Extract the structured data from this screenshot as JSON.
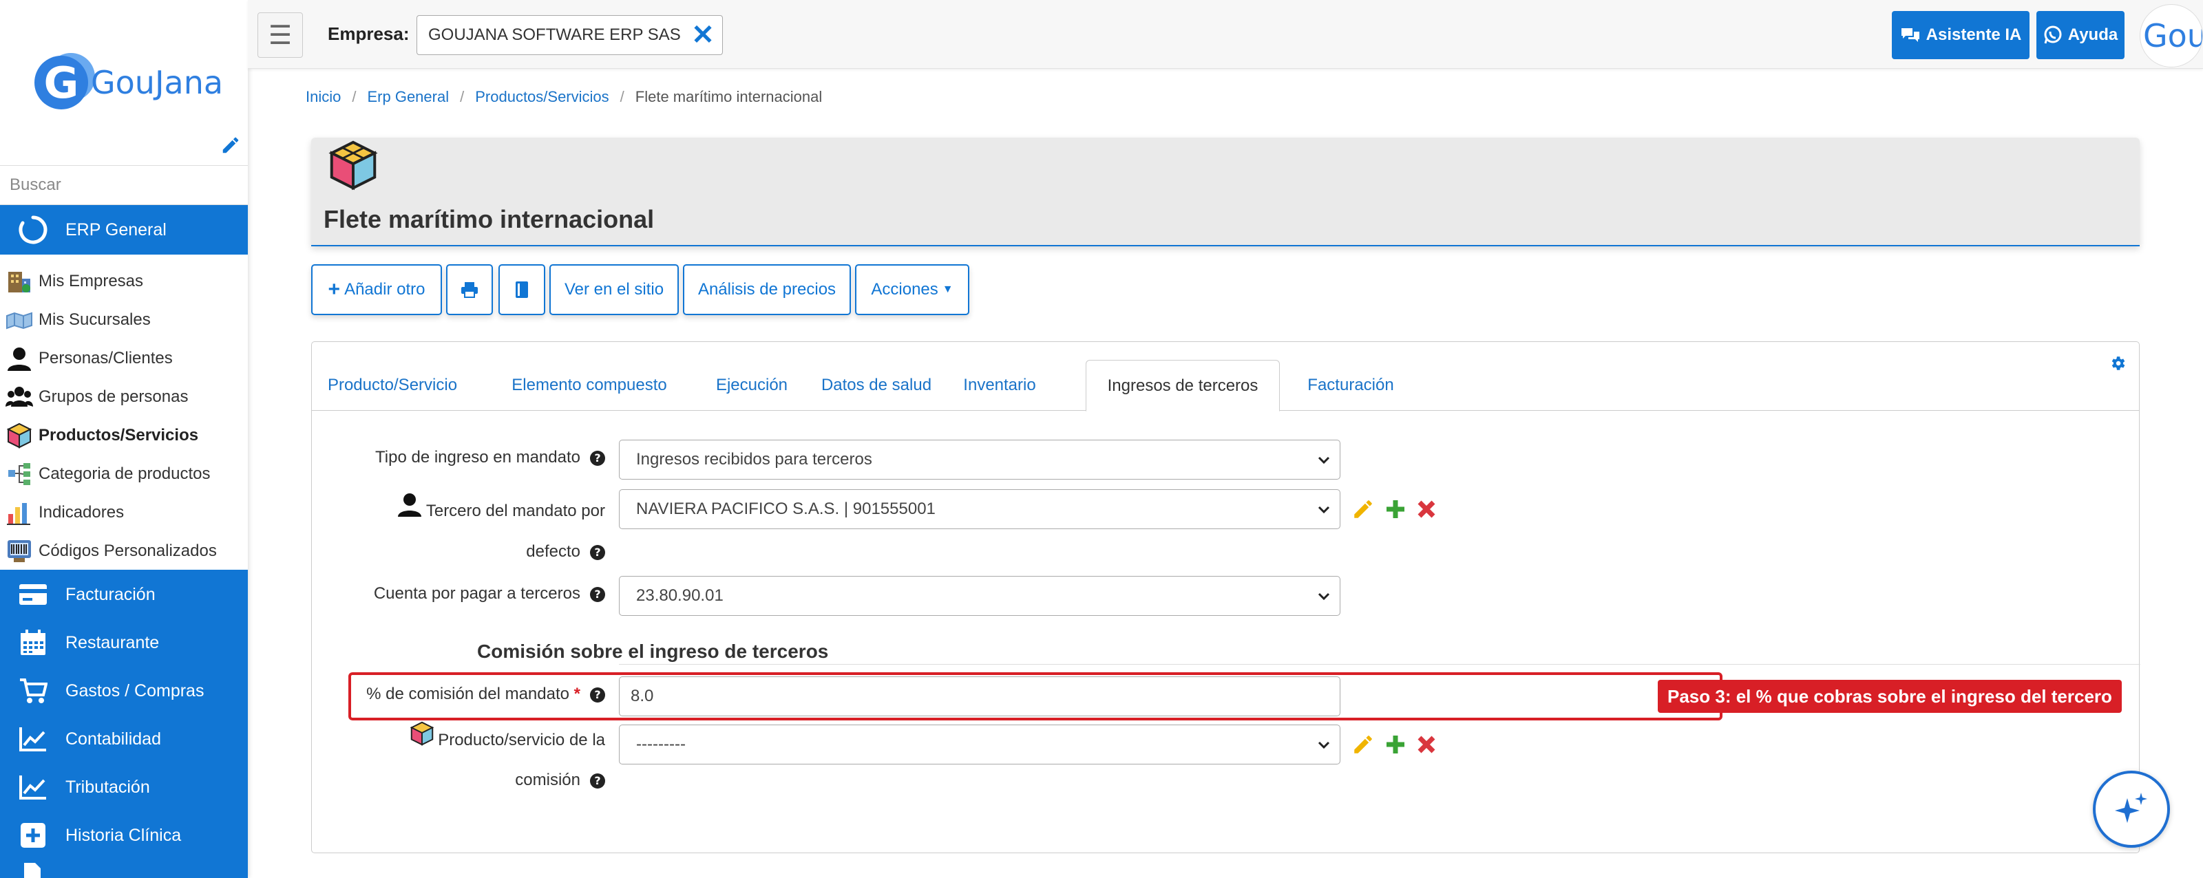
{
  "sidebar": {
    "logo_text": "GouJana",
    "logo_letter": "G",
    "search_placeholder": "Buscar",
    "groups": [
      {
        "label": "ERP General",
        "icon": "circle-notch-icon"
      },
      {
        "label": "Facturación",
        "icon": "credit-card-icon"
      },
      {
        "label": "Restaurante",
        "icon": "calendar-icon"
      },
      {
        "label": "Gastos / Compras",
        "icon": "shopping-cart-icon"
      },
      {
        "label": "Contabilidad",
        "icon": "line-chart-icon"
      },
      {
        "label": "Tributación",
        "icon": "line-chart-icon"
      },
      {
        "label": "Historia Clínica",
        "icon": "plus-square-icon"
      }
    ],
    "items": [
      {
        "label": "Mis Empresas",
        "icon": "building-icon"
      },
      {
        "label": "Mis Sucursales",
        "icon": "map-icon"
      },
      {
        "label": "Personas/Clientes",
        "icon": "user-icon"
      },
      {
        "label": "Grupos de personas",
        "icon": "users-icon"
      },
      {
        "label": "Productos/Servicios",
        "icon": "cube-icon",
        "active": true
      },
      {
        "label": "Categoria de productos",
        "icon": "sitemap-icon"
      },
      {
        "label": "Indicadores",
        "icon": "bar-chart-icon"
      },
      {
        "label": "Códigos Personalizados",
        "icon": "barcode-icon"
      }
    ]
  },
  "topbar": {
    "empresa_label": "Empresa:",
    "empresa_value": "GOUJANA SOFTWARE ERP SAS",
    "asistente_label": "Asistente IA",
    "ayuda_label": "Ayuda",
    "avatar_text": "Gou"
  },
  "breadcrumb": [
    "Inicio",
    "Erp General",
    "Productos/Servicios",
    "Flete marítimo internacional"
  ],
  "page": {
    "title": "Flete marítimo internacional"
  },
  "actions": {
    "add_other": "Añadir otro",
    "view_site": "Ver en el sitio",
    "price_analysis": "Análisis de precios",
    "actions": "Acciones"
  },
  "tabs": [
    "Producto/Servicio",
    "Elemento compuesto",
    "Ejecución",
    "Datos de salud",
    "Inventario",
    "Ingresos de terceros",
    "Facturación"
  ],
  "active_tab": "Ingresos de terceros",
  "form": {
    "tipo_ingreso_label": "Tipo de ingreso en mandato",
    "tipo_ingreso_value": "Ingresos recibidos para terceros",
    "tercero_label_1": "Tercero del mandato por",
    "tercero_label_2": "defecto",
    "tercero_value": "NAVIERA PACIFICO S.A.S. | 901555001",
    "cuenta_label": "Cuenta por pagar a terceros",
    "cuenta_value": "23.80.90.01",
    "section_title": "Comisión sobre el ingreso de terceros",
    "comision_label": "% de comisión del mandato",
    "required_mark": "*",
    "comision_value": "8.0",
    "producto_label_1": "Producto/servicio de la",
    "producto_label_2": "comisión",
    "producto_value": "---------"
  },
  "callout": "Paso 3: el % que cobras sobre el ingreso del tercero",
  "colors": {
    "primary": "#1176d4",
    "highlight": "#d81f26",
    "edit": "#f0b400",
    "add": "#3aa335",
    "remove": "#d9363e"
  }
}
